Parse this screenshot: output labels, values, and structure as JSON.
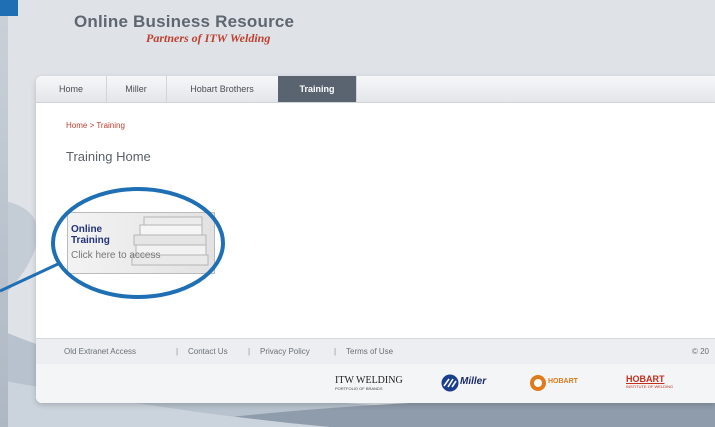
{
  "header": {
    "title": "Online Business Resource",
    "subtitle": "Partners of ITW Welding"
  },
  "nav": {
    "items": [
      {
        "label": "Home"
      },
      {
        "label": "Miller"
      },
      {
        "label": "Hobart Brothers"
      },
      {
        "label": "Training",
        "active": true
      }
    ]
  },
  "breadcrumb": "Home > Training",
  "page_title": "Training Home",
  "card": {
    "line1": "Online",
    "line2": "Training",
    "cta": "Click here to access"
  },
  "footer": {
    "links": [
      "Old Extranet Access",
      "Contact Us",
      "Privacy Policy",
      "Terms of Use"
    ],
    "separator": "|",
    "copyright": "© 20"
  },
  "logos": {
    "itw": "ITW WELDING",
    "itw_sub": "PORTFOLIO OF BRANDS",
    "miller": "Miller",
    "hobart": "HOBART",
    "hobart_inst": "HOBART",
    "hobart_inst_sub": "INSTITUTE OF WELDING"
  },
  "colors": {
    "accent_blue": "#1f6fb4",
    "brand_red": "#c0402f",
    "nav_active": "#5a6470"
  }
}
